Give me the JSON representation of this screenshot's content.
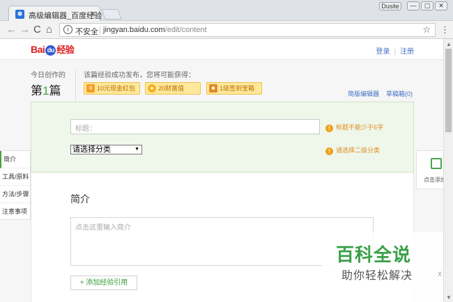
{
  "browser": {
    "tab_title": "高级编辑器_百度经验",
    "tab_close": "×",
    "profile_label": "Dusite",
    "win_min": "—",
    "win_max": "▢",
    "win_close": "✕",
    "back": "←",
    "forward": "→",
    "reload": "C",
    "home": "⌂",
    "info_icon": "i",
    "insecure_label": "不安全",
    "url_host": "jingyan.baidu.com",
    "url_path": "/edit/content",
    "star": "☆",
    "menu": "⋮"
  },
  "header": {
    "logo_bai": "Bai",
    "logo_du": "du",
    "logo_jy": "经验",
    "login": "登录",
    "register": "注册"
  },
  "stats": {
    "label": "今日创作的",
    "prefix": "第",
    "count": "1",
    "suffix": "篇"
  },
  "rewards": {
    "title": "该篇经验成功发布，您将可能获得：",
    "items": [
      {
        "icon": "red-packet-icon",
        "glyph": "¥",
        "label": "10元现金红包"
      },
      {
        "icon": "coin-icon",
        "glyph": "●",
        "label": "20财富值"
      },
      {
        "icon": "treasure-box-icon",
        "glyph": "■",
        "label": "1级签到宝箱"
      }
    ]
  },
  "editor_links": {
    "simple": "简版编辑器",
    "drafts": "草稿箱(0)"
  },
  "form": {
    "title_placeholder": "标题：",
    "title_warning": "标题不能少于6字",
    "warn_glyph": "!",
    "category_selected": "请选择分类",
    "category_warning": "请选择二级分类",
    "select_arrow": "▼"
  },
  "intro": {
    "heading": "简介",
    "placeholder": "点击这里输入简介",
    "add_reference": "+ 添加经验引用"
  },
  "leftnav": {
    "items": [
      "简介",
      "工具/原料",
      "方法/步骤",
      "注意事项"
    ]
  },
  "rightwidget": {
    "label": "点击添加"
  },
  "watermark": {
    "big": "百科全说",
    "small": "助你轻松解决",
    "extra": "X"
  }
}
